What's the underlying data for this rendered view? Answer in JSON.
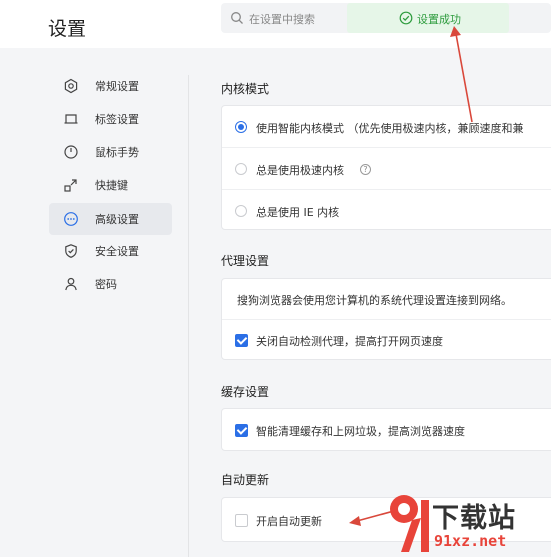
{
  "app": {
    "title": "设置"
  },
  "search": {
    "placeholder": "在设置中搜索"
  },
  "toast": {
    "text": "设置成功",
    "color": "#2e9c3e"
  },
  "sidebar": {
    "items": [
      {
        "label": "常规设置",
        "icon": "settings-hex-icon",
        "active": false
      },
      {
        "label": "标签设置",
        "icon": "tab-icon",
        "active": false
      },
      {
        "label": "鼠标手势",
        "icon": "mouse-icon",
        "active": false
      },
      {
        "label": "快捷键",
        "icon": "shortcut-icon",
        "active": false
      },
      {
        "label": "高级设置",
        "icon": "more-dots-icon",
        "active": true
      },
      {
        "label": "安全设置",
        "icon": "shield-icon",
        "active": false
      },
      {
        "label": "密码",
        "icon": "user-icon",
        "active": false
      }
    ]
  },
  "kernel": {
    "title": "内核模式",
    "options": [
      {
        "label": "使用智能内核模式 （优先使用极速内核，兼顾速度和兼",
        "checked": true
      },
      {
        "label": "总是使用极速内核",
        "checked": false
      },
      {
        "label": "总是使用 IE 内核",
        "checked": false
      }
    ]
  },
  "proxy": {
    "title": "代理设置",
    "description": "搜狗浏览器会使用您计算机的系统代理设置连接到网络。",
    "checkbox_label": "关闭自动检测代理，提高打开网页速度",
    "checked": true
  },
  "cache": {
    "title": "缓存设置",
    "checkbox_label": "智能清理缓存和上网垃圾，提高浏览器速度",
    "checked": true
  },
  "update": {
    "title": "自动更新",
    "checkbox_label": "开启自动更新",
    "checked": false
  },
  "watermark": {
    "brand": "下载站",
    "domain": "91xz.net"
  },
  "colors": {
    "accent": "#2b6fe6",
    "annotation_arrow": "#d9483b"
  }
}
